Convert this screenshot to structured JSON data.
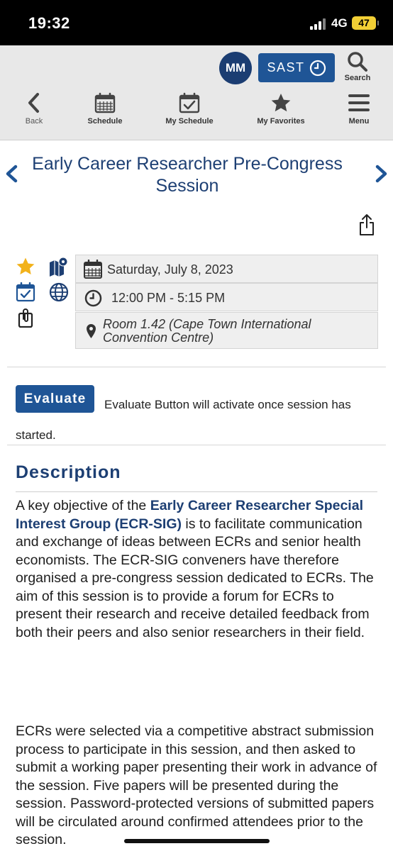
{
  "status_bar": {
    "time": "19:32",
    "network": "4G",
    "battery": "47"
  },
  "header": {
    "avatar_initials": "MM",
    "timezone_label": "SAST",
    "search_label": "Search",
    "nav": [
      {
        "label": "Back",
        "icon": "chevron-left-icon"
      },
      {
        "label": "Schedule",
        "icon": "calendar-icon"
      },
      {
        "label": "My Schedule",
        "icon": "calendar-check-icon"
      },
      {
        "label": "My Favorites",
        "icon": "star-icon"
      },
      {
        "label": "Menu",
        "icon": "hamburger-icon"
      }
    ]
  },
  "session": {
    "title": "Early Career Researcher Pre-Congress Session",
    "date": "Saturday, July 8, 2023",
    "time": "12:00 PM - 5:15 PM",
    "location": "Room 1.42 (Cape Town International Convention Centre)"
  },
  "evaluate": {
    "button_label": "Evaluate",
    "note": "Evaluate Button will activate once session has started."
  },
  "description": {
    "heading": "Description",
    "p1_before": "A key objective of the ",
    "p1_highlight": "Early Career Researcher Special Interest Group (ECR-SIG)",
    "p1_after": " is to facilitate communication and exchange of ideas between ECRs and senior health economists. The ECR-SIG conveners have therefore organised a pre-congress session dedicated to ECRs. The aim of this session is to provide a forum for ECRs to present their research and receive detailed feedback from both their peers and also senior researchers in their field.",
    "p2": "ECRs were selected via a competitive abstract submission process to participate in this session, and then asked to submit a working paper presenting their work in advance of the session. Five papers will be presented during the session. Password-protected versions of submitted papers will be circulated around confirmed attendees prior to the session."
  },
  "colors": {
    "brand_navy": "#1d3f73",
    "button_blue": "#1f5596",
    "star_gold": "#f2b21b"
  }
}
